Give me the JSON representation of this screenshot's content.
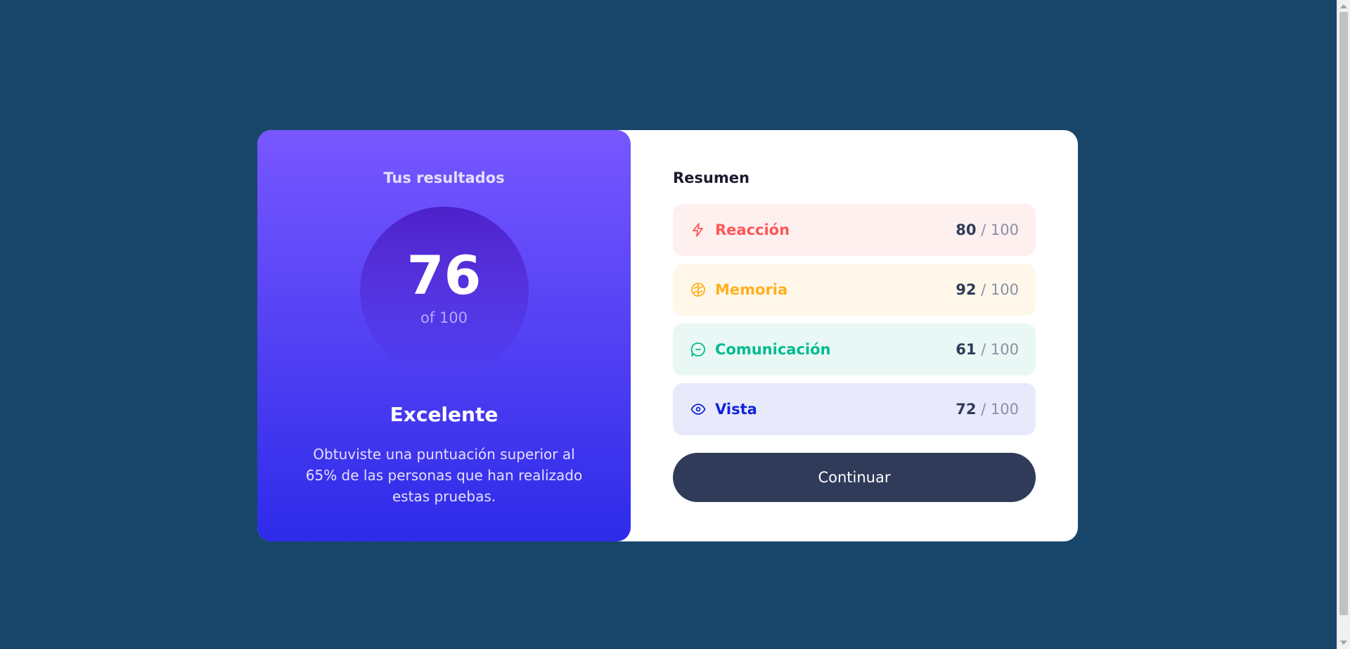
{
  "results": {
    "heading": "Tus resultados",
    "score": 76,
    "score_of": "of 100",
    "score_fraction": 0.76,
    "rating": "Excelente",
    "description": "Obtuviste una puntuación superior al 65% de las personas que han realizado estas pruebas."
  },
  "summary": {
    "heading": "Resumen",
    "separator": "/",
    "max": "100",
    "items": [
      {
        "label": "Reacción",
        "value": "80",
        "icon": "lightning-icon",
        "color": "#ff5757",
        "bg": "#fff0f0"
      },
      {
        "label": "Memoria",
        "value": "92",
        "icon": "brain-icon",
        "color": "#ffb01f",
        "bg": "#fff8ea"
      },
      {
        "label": "Comunicación",
        "value": "61",
        "icon": "chat-bubble-icon",
        "color": "#00bb8f",
        "bg": "#e9f8f4"
      },
      {
        "label": "Vista",
        "value": "72",
        "icon": "eye-icon",
        "color": "#1125d6",
        "bg": "#e8eafc"
      }
    ],
    "button_label": "Continuar"
  },
  "colors": {
    "page_background": "#18466b",
    "button_background": "#303b5a"
  }
}
